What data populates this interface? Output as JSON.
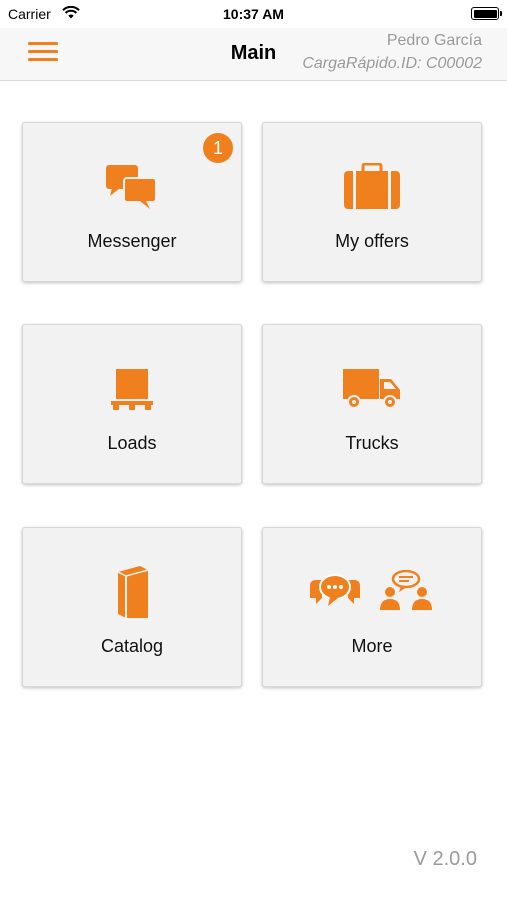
{
  "status_bar": {
    "carrier": "Carrier",
    "time": "10:37 AM"
  },
  "nav": {
    "title": "Main",
    "user_name": "Pedro García",
    "user_id": "CargaRápido.ID: C00002"
  },
  "tiles": [
    {
      "label": "Messenger",
      "icon": "chat-bubbles-icon",
      "badge": "1"
    },
    {
      "label": "My offers",
      "icon": "briefcase-icon"
    },
    {
      "label": "Loads",
      "icon": "pallet-box-icon"
    },
    {
      "label": "Trucks",
      "icon": "truck-icon"
    },
    {
      "label": "Catalog",
      "icon": "book-icon"
    },
    {
      "label": "More",
      "icon": "community-chat-icon"
    }
  ],
  "footer": {
    "version": "V 2.0.0"
  },
  "colors": {
    "accent": "#f0801e",
    "tile_bg": "#f2f2f2",
    "muted_text": "#9a9a9a"
  }
}
